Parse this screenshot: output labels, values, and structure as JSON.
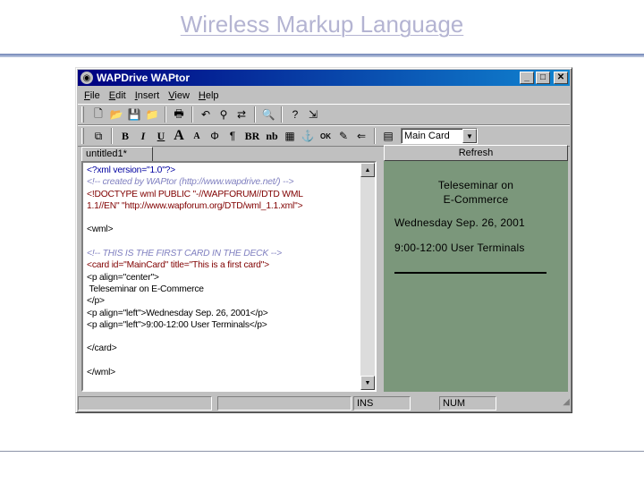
{
  "slide": {
    "title": "Wireless Markup Language"
  },
  "window": {
    "title": "WAPDrive WAPtor",
    "controls": {
      "minimize": "_",
      "maximize": "□",
      "close": "✕"
    }
  },
  "menu": [
    {
      "acc": "F",
      "rest": "ile"
    },
    {
      "acc": "E",
      "rest": "dit"
    },
    {
      "acc": "I",
      "rest": "nsert"
    },
    {
      "acc": "V",
      "rest": "iew"
    },
    {
      "acc": "H",
      "rest": "elp"
    }
  ],
  "toolbar2": {
    "bold": "B",
    "italic": "I",
    "underline": "U",
    "big": "A",
    "small": "A",
    "paragraph": "¶",
    "br": "BR",
    "nb": "nb",
    "ok": "OK",
    "card_select": "Main Card"
  },
  "tabs": {
    "document": "untitled1*",
    "refresh": "Refresh"
  },
  "editor": {
    "lines": [
      {
        "text": "<?xml version=\"1.0\"?>",
        "style": "c-blue"
      },
      {
        "text": "<!-- created by WAPtor (http://www.wapdrive.net/) -->",
        "style": "c-comment"
      },
      {
        "text": "<!DOCTYPE wml PUBLIC \"-//WAPFORUM//DTD WML",
        "style": "c-maroon"
      },
      {
        "text": "1.1//EN\" \"http://www.wapforum.org/DTD/wml_1.1.xml\">",
        "style": "c-maroon"
      },
      {
        "text": "",
        "style": "c-black"
      },
      {
        "text": "<wml>",
        "style": "c-black"
      },
      {
        "text": "",
        "style": "c-black"
      },
      {
        "text": "<!-- THIS IS THE FIRST CARD IN THE DECK -->",
        "style": "c-comment"
      },
      {
        "text": "<card id=\"MainCard\" title=\"This is a first card\">",
        "style": "c-maroon"
      },
      {
        "text": "<p align=\"center\">",
        "style": "c-black"
      },
      {
        "text": " Teleseminar on E-Commerce",
        "style": "c-black"
      },
      {
        "text": "</p>",
        "style": "c-black"
      },
      {
        "text": "<p align=\"left\">Wednesday Sep. 26, 2001</p>",
        "style": "c-black"
      },
      {
        "text": "<p align=\"left\">9:00-12:00 User Terminals</p>",
        "style": "c-black"
      },
      {
        "text": "",
        "style": "c-black"
      },
      {
        "text": "</card>",
        "style": "c-black"
      },
      {
        "text": "",
        "style": "c-black"
      },
      {
        "text": "</wml>",
        "style": "c-black"
      }
    ]
  },
  "preview": {
    "center_line1": "Teleseminar on",
    "center_line2": "E-Commerce",
    "left_line1": "Wednesday Sep. 26, 2001",
    "left_line2": "9:00-12:00 User Terminals"
  },
  "status": {
    "ins": "INS",
    "num": "NUM"
  }
}
